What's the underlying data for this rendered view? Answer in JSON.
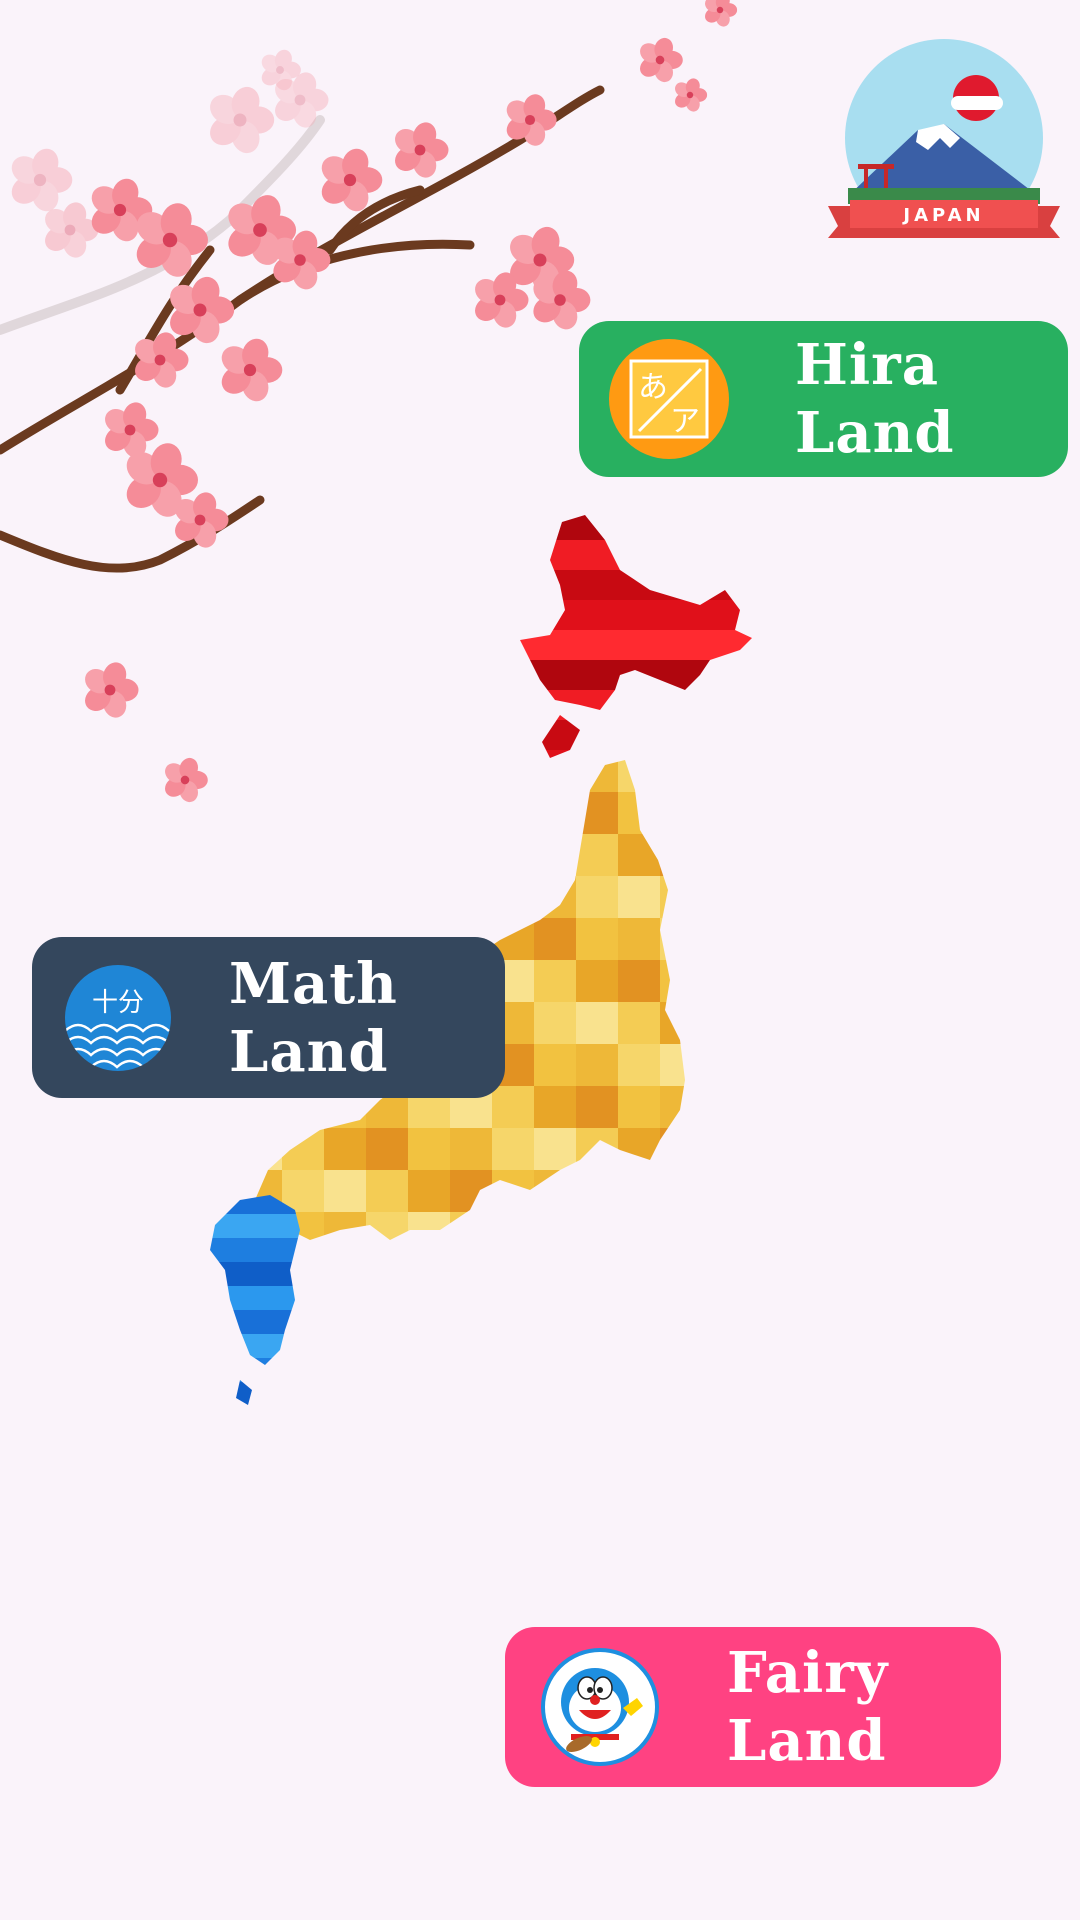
{
  "badge": {
    "text": "JAPAN"
  },
  "lands": [
    {
      "id": "hira",
      "line1": "Hira",
      "line2": "Land",
      "icon": "hiragana-katakana-icon",
      "color": "#28b060"
    },
    {
      "id": "math",
      "line1": "Math",
      "line2": "Land",
      "icon": "math-wave-icon",
      "icon_text": "十分",
      "color": "#34475d"
    },
    {
      "id": "fairy",
      "line1": "Fairy",
      "line2": "Land",
      "icon": "doraemon-icon",
      "color": "#ff4282"
    }
  ],
  "hira_icon": {
    "top": "あ",
    "bottom": "ア"
  },
  "map": {
    "regions": [
      {
        "name": "hokkaido",
        "color": "#e0101a"
      },
      {
        "name": "honshu",
        "color": "#f2c240"
      },
      {
        "name": "kyushu",
        "color": "#1e7ee0"
      }
    ]
  },
  "colors": {
    "background": "#faf3fa",
    "blossom": "#f58c98",
    "branch": "#6b3a1f"
  }
}
